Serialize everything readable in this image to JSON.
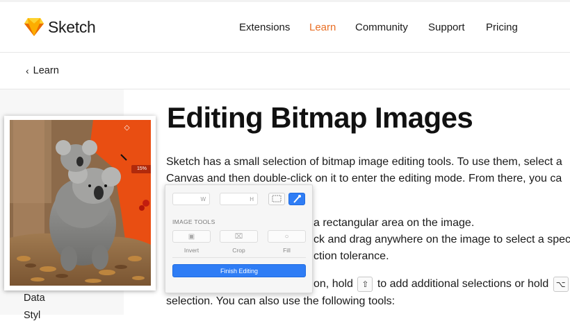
{
  "brand": {
    "name": "Sketch"
  },
  "nav": {
    "items": [
      {
        "label": "Extensions"
      },
      {
        "label": "Learn",
        "active": true
      },
      {
        "label": "Community"
      },
      {
        "label": "Support"
      },
      {
        "label": "Pricing"
      }
    ]
  },
  "breadcrumb": {
    "label": "Learn"
  },
  "sidebar": {
    "items": [
      {
        "label": "Data"
      },
      {
        "label": "Styl"
      }
    ]
  },
  "article": {
    "title": "Editing Bitmap Images",
    "intro_line1": "Sketch has a small selection of bitmap image editing tools. To use them, select a",
    "intro_line2": "Canvas and then double-click on it to enter the editing mode. From there, you ca",
    "list_line1": "a rectangular area on the image.",
    "list_line2": "ck and drag anywhere on the image to select a speci",
    "list_line3": "ction tolerance.",
    "shift_prefix": "on, hold",
    "shift_suffix": "to add additional selections or hold",
    "line_last": "selection. You can also use the following tools:"
  },
  "image": {
    "zoom_badge": "15%"
  },
  "inspector": {
    "width_placeholder": "W",
    "height_placeholder": "H",
    "section_label": "IMAGE TOOLS",
    "tools": [
      {
        "label": "Invert"
      },
      {
        "label": "Crop"
      },
      {
        "label": "Fill"
      }
    ],
    "finish_label": "Finish Editing"
  },
  "colors": {
    "accent": "#e96f25",
    "primary_button": "#2f7df5",
    "image_background": "#e94e12"
  },
  "icons": {
    "logo": "sketch-diamond-icon",
    "shift_key": "shift-key-icon",
    "option_key": "option-key-icon",
    "marquee": "marquee-icon",
    "magic_wand": "magic-wand-icon",
    "invert": "invert-icon",
    "crop": "crop-icon",
    "fill": "fill-drop-icon"
  }
}
